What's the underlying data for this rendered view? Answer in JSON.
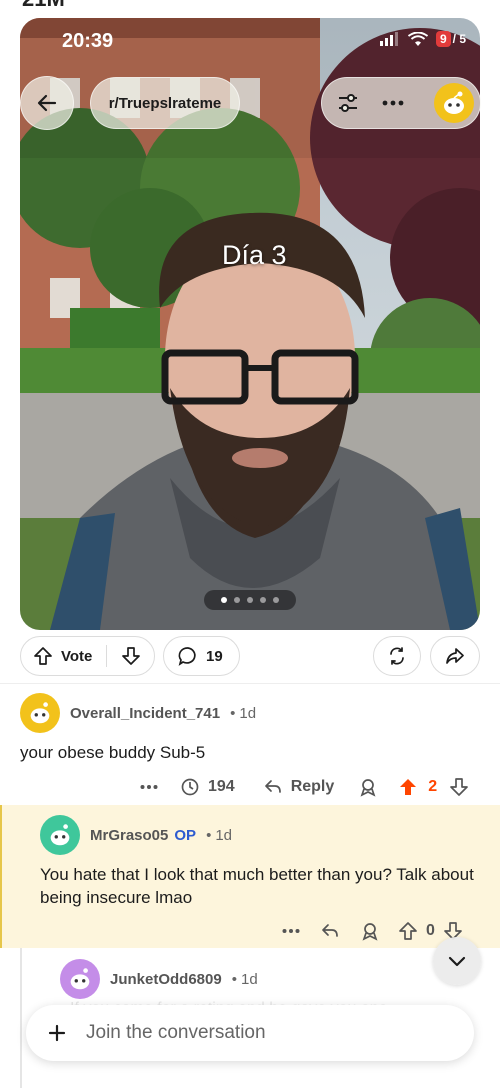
{
  "status_bar": {
    "time": "20:39",
    "battery": "9",
    "battery_suffix": "/ 5"
  },
  "top_partial_text": "21M",
  "header": {
    "subreddit": "r/Truepslrateme"
  },
  "media": {
    "overlay_text": "Día 3",
    "page_count": 5,
    "current_page": 1
  },
  "post_actions": {
    "vote_label": "Vote",
    "comment_count": "19"
  },
  "comments": [
    {
      "author": "Overall_Incident_741",
      "age": "1d",
      "body": "your obese buddy Sub-5",
      "views": "194",
      "reply_label": "Reply",
      "score": "2",
      "avatar_color": "#f2c21b"
    },
    {
      "author": "MrGraso05",
      "op_badge": "OP",
      "age": "1d",
      "body": "You hate that I look that much better than you? Talk about being insecure lmao",
      "score": "0",
      "avatar_color": "#3fc79b"
    },
    {
      "author": "JunketOdd6809",
      "age": "1d",
      "body_partial": "If you came for a rating and he gave you one",
      "avatar_color": "#c48de8"
    }
  ],
  "composer": {
    "placeholder": "Join the conversation"
  },
  "colors": {
    "upvote_active": "#ff4500",
    "op_badge": "#2d5bd0",
    "highlight_bg": "#fdf5dc"
  }
}
